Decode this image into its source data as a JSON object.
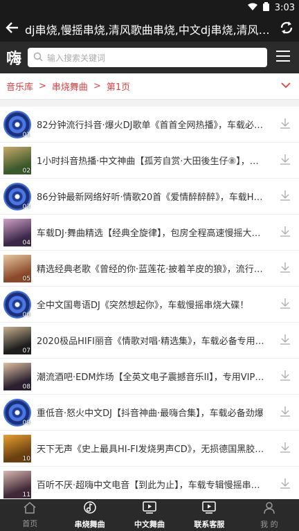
{
  "status": {
    "time": "3:03"
  },
  "topbar": {
    "title": "dj串烧,慢摇串烧,清风歌曲串烧,中文dj串烧,清风dj串烧"
  },
  "search": {
    "logo": "嗨",
    "placeholder": "输入搜索关键词"
  },
  "breadcrumb": {
    "items": [
      "音乐库",
      "串烧舞曲",
      "第1页"
    ]
  },
  "tracks": [
    {
      "num": "01",
      "title": "82分钟流行抖音·爆火DJ歌单《首首全网热播》，车载必备劲爆串烧",
      "thumb": "disc"
    },
    {
      "num": "02",
      "title": "1小时抖音热播·中文神曲【孤芳自赏·大田後生仔⑧】，车载必备",
      "thumb": "photo",
      "colors": [
        "#3a5a2a",
        "#c9a86a"
      ]
    },
    {
      "num": "03",
      "title": "86分钟最新网络好听·情歌20首《爱情醉醉醉》，车载HIFI音质",
      "thumb": "disc"
    },
    {
      "num": "04",
      "title": "车载DJ·舞曲精选【经典全旋律】，包房全程高速慢摇大碟串烧",
      "thumb": "photo",
      "colors": [
        "#3a2848",
        "#d0a0c8"
      ]
    },
    {
      "num": "05",
      "title": "精选经典老歌《曾经的你·蓝莲花·披着羊皮的狼》，流行串烧",
      "thumb": "photo",
      "colors": [
        "#8a4a2a",
        "#e8c8a0"
      ]
    },
    {
      "num": "06",
      "title": "全中文国粤语DJ《突然想起你》，车载慢摇串烧大碟！",
      "thumb": "disc"
    },
    {
      "num": "07",
      "title": "2020极品HIFI丽音《情歌对唱·精选集》，车载必备专用连版",
      "thumb": "photo",
      "colors": [
        "#1e1e1e",
        "#c8b090"
      ]
    },
    {
      "num": "08",
      "title": "潮流酒吧·EDM炸场【全英文电子震撼音乐II】，专用VIP串烧",
      "thumb": "photo",
      "colors": [
        "#2a2030",
        "#e0c0a0"
      ]
    },
    {
      "num": "09",
      "title": "重低音·怒火中文DJ【抖音神曲·最嗨合集】，车载必备劲爆",
      "thumb": "disc"
    },
    {
      "num": "10",
      "title": "天下无声《史上最具HI-FI发烧男声CD》，无损德国黑胶大碟",
      "thumb": "photo",
      "colors": [
        "#6a4010",
        "#e8a030"
      ]
    },
    {
      "num": "11",
      "title": "百听不厌·超嗨中文电音【到此为止】，车载专辑慢摇串烧精选",
      "thumb": "photo",
      "colors": [
        "#402838",
        "#d8b8b0"
      ]
    }
  ],
  "tabs": [
    {
      "label": "首页",
      "icon": "home-icon",
      "active": false
    },
    {
      "label": "串烧舞曲",
      "icon": "music-note-icon",
      "active": true
    },
    {
      "label": "中文舞曲",
      "icon": "video-play-icon",
      "active": true
    },
    {
      "label": "联系客服",
      "icon": "tv-play-icon",
      "active": true
    },
    {
      "label": "我 的",
      "icon": "user-icon",
      "active": false
    }
  ],
  "colors": {
    "accent": "#e04040",
    "dark": "#1a1a1a"
  }
}
